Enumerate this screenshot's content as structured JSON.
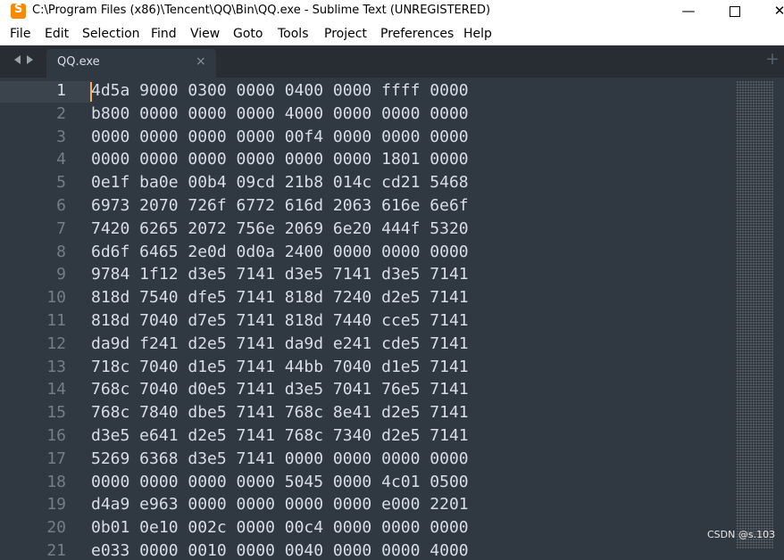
{
  "window": {
    "title": "C:\\Program Files (x86)\\Tencent\\QQ\\Bin\\QQ.exe - Sublime Text (UNREGISTERED)",
    "minimize": "—",
    "close": "✕"
  },
  "menu": [
    "File",
    "Edit",
    "Selection",
    "Find",
    "View",
    "Goto",
    "Tools",
    "Project",
    "Preferences",
    "Help"
  ],
  "tabs": {
    "active_label": "QQ.exe",
    "close_glyph": "×",
    "new_tab_glyph": "+"
  },
  "editor": {
    "current_line": 1,
    "lines": [
      {
        "num": "1",
        "text": "4d5a 9000 0300 0000 0400 0000 ffff 0000"
      },
      {
        "num": "2",
        "text": "b800 0000 0000 0000 4000 0000 0000 0000"
      },
      {
        "num": "3",
        "text": "0000 0000 0000 0000 00f4 0000 0000 0000"
      },
      {
        "num": "4",
        "text": "0000 0000 0000 0000 0000 0000 1801 0000"
      },
      {
        "num": "5",
        "text": "0e1f ba0e 00b4 09cd 21b8 014c cd21 5468"
      },
      {
        "num": "6",
        "text": "6973 2070 726f 6772 616d 2063 616e 6e6f"
      },
      {
        "num": "7",
        "text": "7420 6265 2072 756e 2069 6e20 444f 5320"
      },
      {
        "num": "8",
        "text": "6d6f 6465 2e0d 0d0a 2400 0000 0000 0000"
      },
      {
        "num": "9",
        "text": "9784 1f12 d3e5 7141 d3e5 7141 d3e5 7141"
      },
      {
        "num": "10",
        "text": "818d 7540 dfe5 7141 818d 7240 d2e5 7141"
      },
      {
        "num": "11",
        "text": "818d 7040 d7e5 7141 818d 7440 cce5 7141"
      },
      {
        "num": "12",
        "text": "da9d f241 d2e5 7141 da9d e241 cde5 7141"
      },
      {
        "num": "13",
        "text": "718c 7040 d1e5 7141 44bb 7040 d1e5 7141"
      },
      {
        "num": "14",
        "text": "768c 7040 d0e5 7141 d3e5 7041 76e5 7141"
      },
      {
        "num": "15",
        "text": "768c 7840 dbe5 7141 768c 8e41 d2e5 7141"
      },
      {
        "num": "16",
        "text": "d3e5 e641 d2e5 7141 768c 7340 d2e5 7141"
      },
      {
        "num": "17",
        "text": "5269 6368 d3e5 7141 0000 0000 0000 0000"
      },
      {
        "num": "18",
        "text": "0000 0000 0000 0000 5045 0000 4c01 0500"
      },
      {
        "num": "19",
        "text": "d4a9 e963 0000 0000 0000 0000 e000 2201"
      },
      {
        "num": "20",
        "text": "0b01 0e10 002c 0000 00c4 0000 0000 0000"
      },
      {
        "num": "21",
        "text": "e033 0000 0010 0000 0040 0000 0000 4000"
      }
    ]
  },
  "watermark": "CSDN @s.103"
}
